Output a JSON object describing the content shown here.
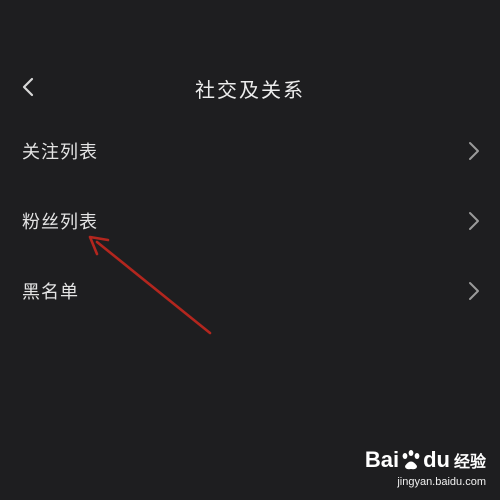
{
  "header": {
    "back_icon": "chevron-left-icon",
    "title": "社交及关系"
  },
  "menu": {
    "items": [
      {
        "label": "关注列表",
        "icon": "chevron-right-icon"
      },
      {
        "label": "粉丝列表",
        "icon": "chevron-right-icon"
      },
      {
        "label": "黑名单",
        "icon": "chevron-right-icon"
      }
    ]
  },
  "annotation": {
    "color": "#b3261e",
    "icon": "red-arrow-annotation"
  },
  "watermark": {
    "logo": "Bai du 经验",
    "url": "jingyan.baidu.com"
  },
  "colors": {
    "background": "#1e1e20",
    "text": "#e4e4e4",
    "chevron": "#9a9a9a"
  }
}
